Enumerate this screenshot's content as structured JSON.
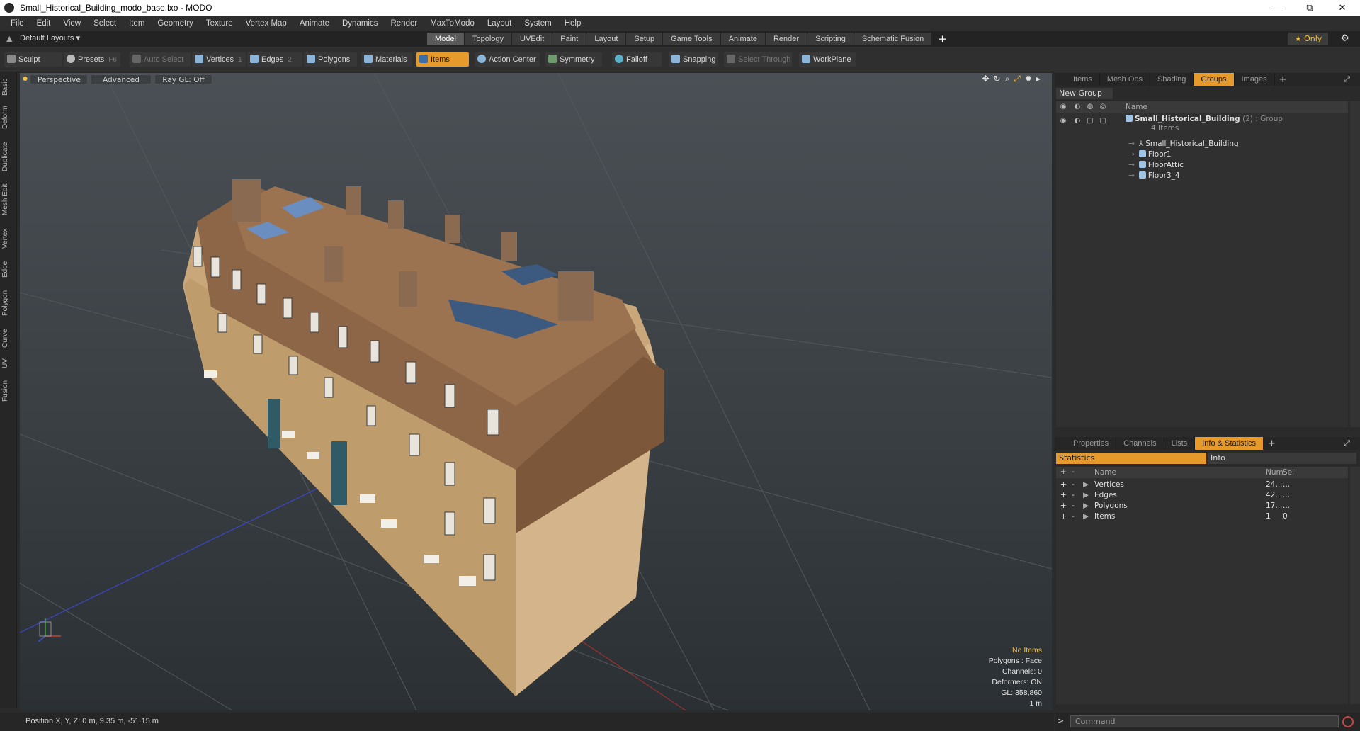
{
  "window": {
    "title": "Small_Historical_Building_modo_base.lxo - MODO",
    "minimize": "—",
    "maximize": "⧉",
    "close": "✕"
  },
  "menu": [
    "File",
    "Edit",
    "View",
    "Select",
    "Item",
    "Geometry",
    "Texture",
    "Vertex Map",
    "Animate",
    "Dynamics",
    "Render",
    "MaxToModo",
    "Layout",
    "System",
    "Help"
  ],
  "layout_bar": {
    "dropdown": "Default Layouts ▾",
    "tabs": [
      "Model",
      "Topology",
      "UVEdit",
      "Paint",
      "Layout",
      "Setup",
      "Game Tools",
      "Animate",
      "Render",
      "Scripting",
      "Schematic Fusion"
    ],
    "active_tab": "Model",
    "add": "+",
    "only": "★  Only"
  },
  "toolbar": {
    "sculpt": "Sculpt",
    "presets": "Presets",
    "presets_key": "F6",
    "auto_select": "Auto Select",
    "vertices": "Vertices",
    "vertices_count": "1",
    "edges": "Edges",
    "edges_count": "2",
    "polygons": "Polygons",
    "materials": "Materials",
    "items": "Items",
    "action_center": "Action Center",
    "symmetry": "Symmetry",
    "falloff": "Falloff",
    "snapping": "Snapping",
    "select_through": "Select Through",
    "workplane": "WorkPlane"
  },
  "left_tabs": [
    "Basic",
    "Deform",
    "Duplicate",
    "Mesh Edit",
    "Vertex",
    "Edge",
    "Polygon",
    "Curve",
    "UV",
    "Fusion"
  ],
  "viewport": {
    "perspective": "Perspective",
    "advanced": "Advanced",
    "raygl": "Ray GL: Off",
    "stats": [
      "No Items",
      "Polygons : Face",
      "Channels: 0",
      "Deformers: ON",
      "GL: 358,860",
      "1 m"
    ]
  },
  "groups_panel": {
    "tabs": [
      "Items",
      "Mesh Ops",
      "Shading",
      "Groups",
      "Images"
    ],
    "active_tab": "Groups",
    "add": "+",
    "new_group": "New Group",
    "col_name": "Name",
    "root": {
      "name": "Small_Historical_Building",
      "suffix": " (2) : Group",
      "count": "4 Items"
    },
    "children": [
      "Small_Historical_Building",
      "Floor1",
      "FloorAttic",
      "Floor3_4"
    ]
  },
  "info_panel": {
    "tabs": [
      "Properties",
      "Channels",
      "Lists",
      "Info & Statistics"
    ],
    "active_tab": "Info & Statistics",
    "add": "+",
    "statistics": "Statistics",
    "info": "Info",
    "columns": [
      "Name",
      "Num",
      "Sel"
    ],
    "rows": [
      {
        "name": "Vertices",
        "num": "24...",
        "sel": "..."
      },
      {
        "name": "Edges",
        "num": "42...",
        "sel": "..."
      },
      {
        "name": "Polygons",
        "num": "17...",
        "sel": "..."
      },
      {
        "name": "Items",
        "num": "1",
        "sel": "0"
      }
    ]
  },
  "status": {
    "position": "Position X, Y, Z:   0 m, 9.35 m, -51.15 m",
    "command_placeholder": "Command"
  },
  "colors": {
    "accent": "#e79a2c",
    "panel": "#2a2a2a",
    "viewport_top": "#4a5055"
  }
}
